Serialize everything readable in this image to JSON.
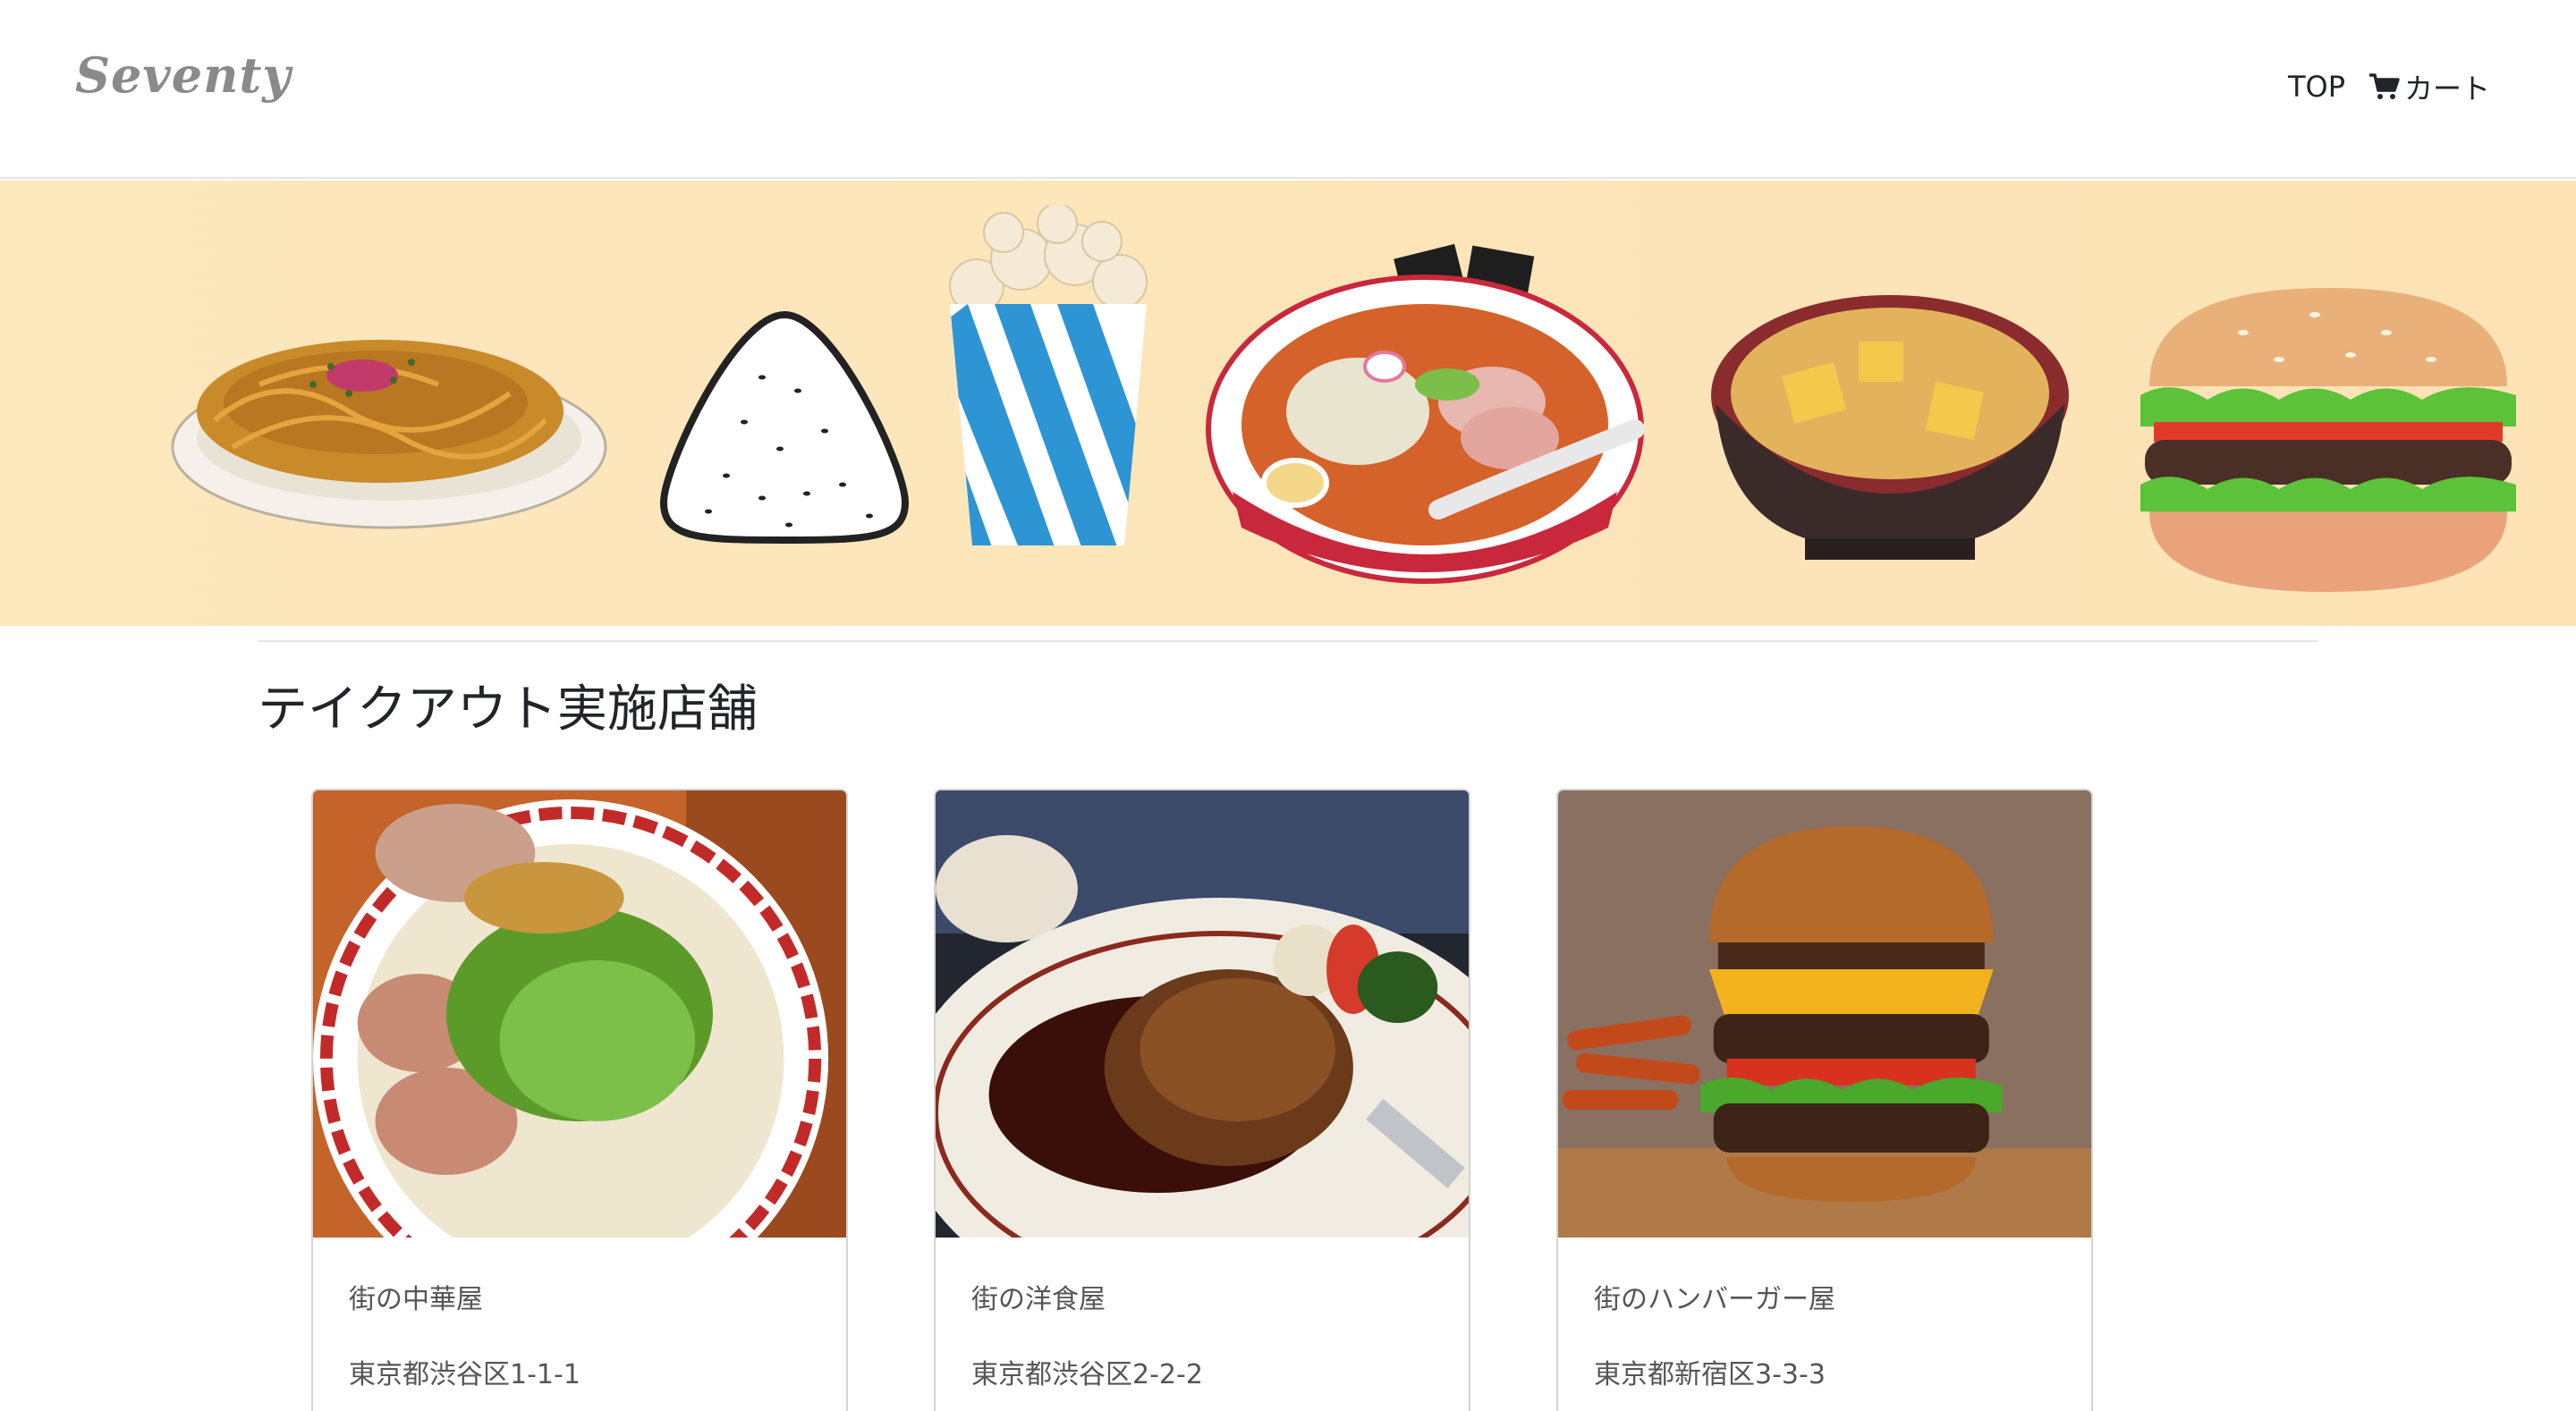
{
  "brand": {
    "name": "Seventy"
  },
  "nav": {
    "top_label": "TOP",
    "cart_label": "カート",
    "cart_icon": "cart-icon"
  },
  "hero": {
    "items": [
      "yakisoba-icon",
      "onigiri-icon",
      "popcorn-icon",
      "ramen-icon",
      "miso-soup-icon",
      "hamburger-icon"
    ]
  },
  "section": {
    "title": "テイクアウト実施店舗"
  },
  "shops": [
    {
      "name": "街の中華屋",
      "address": "東京都渋谷区1-1-1",
      "image": "ramen-photo"
    },
    {
      "name": "街の洋食屋",
      "address": "東京都渋谷区2-2-2",
      "image": "hamburg-steak-photo"
    },
    {
      "name": "街のハンバーガー屋",
      "address": "東京都新宿区3-3-3",
      "image": "burger-photo"
    }
  ],
  "colors": {
    "banner": "#fde7bd",
    "text": "#212529",
    "muted": "#555555",
    "brand": "#8a8a8a"
  }
}
